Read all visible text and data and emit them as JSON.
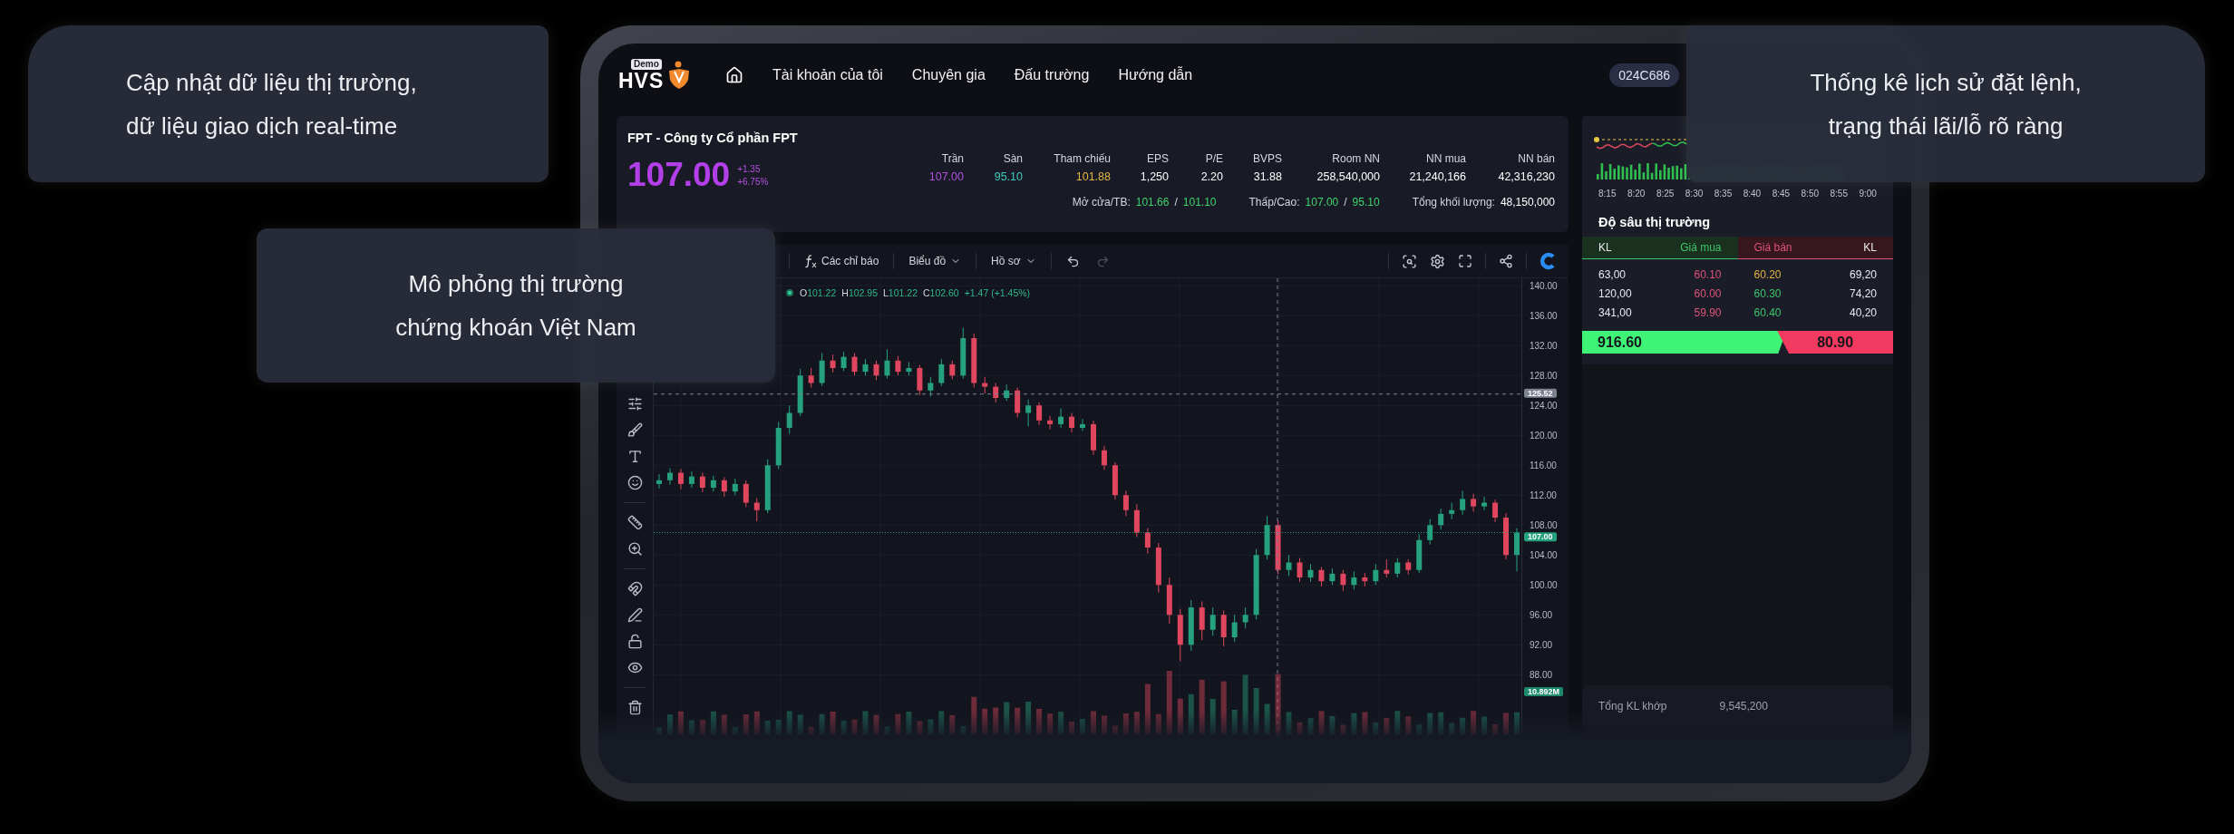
{
  "callouts": [
    {
      "lines": [
        "Cập nhật dữ liệu thị trường,",
        "dữ liệu giao dịch real-time"
      ]
    },
    {
      "lines": [
        "Mô phỏng thị trường",
        "chứng khoán Việt Nam"
      ]
    },
    {
      "lines": [
        "Thống kê lịch sử đặt lệnh,",
        "trạng thái lãi/lỗ rõ ràng"
      ]
    }
  ],
  "header": {
    "logo": {
      "badge": "Demo",
      "text": "HVS"
    },
    "nav": [
      "Tài khoản của tôi",
      "Chuyên gia",
      "Đấu trường",
      "Hướng dẫn"
    ],
    "account": "024C686"
  },
  "quote": {
    "title": "FPT - Công ty Cổ phần FPT",
    "price": "107.00",
    "change": "+1.35",
    "change_pct": "+6.75%",
    "stats": [
      {
        "label": "Trần",
        "value": "107.00",
        "color": "#b34fe0"
      },
      {
        "label": "Sàn",
        "value": "95.10",
        "color": "#3fc8c0"
      },
      {
        "label": "Tham chiếu",
        "value": "101.88",
        "color": "#e6b445"
      },
      {
        "label": "EPS",
        "value": "1,250",
        "color": "#ffffff"
      },
      {
        "label": "P/E",
        "value": "2.20",
        "color": "#ffffff"
      },
      {
        "label": "BVPS",
        "value": "31.88",
        "color": "#ffffff"
      },
      {
        "label": "Room NN",
        "value": "258,540,000",
        "color": "#ffffff"
      },
      {
        "label": "NN mua",
        "value": "21,240,166",
        "color": "#ffffff"
      },
      {
        "label": "NN bán",
        "value": "42,316,230",
        "color": "#ffffff"
      }
    ],
    "summary": [
      {
        "label": "Mở cửa/TB:",
        "values": [
          "101.66",
          "101.10"
        ],
        "separator": "/",
        "color": "#3ed46e"
      },
      {
        "label": "Thấp/Cao:",
        "values": [
          "107.00",
          "95.10"
        ],
        "separator": "/",
        "color": "#3ed46e"
      },
      {
        "label": "Tổng khối lượng:",
        "values": [
          "48,150,000"
        ],
        "color": "#ffffff"
      }
    ]
  },
  "chart_toolbar": {
    "menus": [
      {
        "label": "Các chỉ báo",
        "kind": "indicator"
      },
      {
        "label": "Biểu đồ",
        "kind": "dropdown"
      },
      {
        "label": "Hồ sơ",
        "kind": "dropdown"
      }
    ],
    "undo": {
      "disabled": false
    },
    "redo": {
      "disabled": true
    }
  },
  "chart": {
    "legend": [
      {
        "key": "O",
        "value": "101.22"
      },
      {
        "key": "H",
        "value": "102.95"
      },
      {
        "key": "L",
        "value": "101.22"
      },
      {
        "key": "C",
        "value": "102.60"
      }
    ],
    "legend_change": "+1.47 (+1.45%)",
    "chart_data": {
      "type": "candlestick",
      "grid": true,
      "ylim": [
        73.5,
        141
      ],
      "ref_lines": [
        {
          "axis": "y",
          "value": 125.52,
          "label": "125.52",
          "color": "#7d8291"
        },
        {
          "axis": "y",
          "value": 107,
          "label": "107.00",
          "color": "#26a17f"
        }
      ],
      "yticks": [
        {
          "value": 140,
          "label": "140.00"
        },
        {
          "value": 136,
          "label": "136.00"
        },
        {
          "value": 132,
          "label": "132.00"
        },
        {
          "value": 128,
          "label": "128.00"
        },
        {
          "value": 124,
          "label": "124.00"
        },
        {
          "value": 120,
          "label": "120.00"
        },
        {
          "value": 116,
          "label": "116.00"
        },
        {
          "value": 112,
          "label": "112.00"
        },
        {
          "value": 108,
          "label": "108.00"
        },
        {
          "value": 104,
          "label": "104.00"
        },
        {
          "value": 100,
          "label": "100.00"
        },
        {
          "value": 96,
          "label": "96.00"
        },
        {
          "value": 92,
          "label": "92.00"
        },
        {
          "value": 88,
          "label": "88.00"
        }
      ],
      "ohlc": [
        [
          113.5,
          114.8,
          112.9,
          114
        ],
        [
          114,
          115.6,
          113.4,
          115
        ],
        [
          115,
          115.5,
          112.8,
          113.5
        ],
        [
          113.5,
          115.2,
          113,
          114.5
        ],
        [
          114.5,
          115,
          112.4,
          113
        ],
        [
          113,
          114.6,
          112.5,
          114
        ],
        [
          114,
          114.4,
          111.8,
          112.5
        ],
        [
          112.5,
          114.2,
          112,
          113.5
        ],
        [
          113.5,
          114,
          110.4,
          111
        ],
        [
          111,
          111.6,
          108.5,
          110
        ],
        [
          110,
          116.8,
          109.6,
          116
        ],
        [
          116,
          121.8,
          115.5,
          121
        ],
        [
          121,
          124,
          120.2,
          123
        ],
        [
          123,
          128.9,
          122.6,
          128
        ],
        [
          128,
          129,
          126.4,
          127
        ],
        [
          127,
          131,
          126.6,
          130
        ],
        [
          130,
          130.8,
          128.4,
          129
        ],
        [
          129,
          131.2,
          128.6,
          130.5
        ],
        [
          130.5,
          131,
          128,
          128.5
        ],
        [
          128.5,
          130.2,
          128,
          129.5
        ],
        [
          129.5,
          130,
          127.4,
          128
        ],
        [
          128,
          131.5,
          127.6,
          130
        ],
        [
          130,
          130.6,
          128,
          128.5
        ],
        [
          128.5,
          129.8,
          128,
          129
        ],
        [
          129,
          129.4,
          125.4,
          126
        ],
        [
          126,
          127.8,
          125.2,
          127
        ],
        [
          127,
          130.2,
          126.6,
          129.5
        ],
        [
          129.5,
          130,
          127.5,
          128
        ],
        [
          128,
          134.4,
          127.6,
          133
        ],
        [
          133,
          133.6,
          126.4,
          127
        ],
        [
          127,
          127.8,
          125.6,
          126.5
        ],
        [
          126.5,
          127,
          124.4,
          125
        ],
        [
          125,
          126.8,
          124.6,
          126
        ],
        [
          126,
          126.4,
          122.4,
          123
        ],
        [
          123,
          124.8,
          121.2,
          124
        ],
        [
          124,
          124.4,
          121.4,
          122
        ],
        [
          122,
          122.6,
          120.8,
          121.5
        ],
        [
          121.5,
          123.6,
          121,
          122.5
        ],
        [
          122.5,
          123,
          120.4,
          121
        ],
        [
          121,
          122.2,
          120.6,
          121.5
        ],
        [
          121.5,
          122,
          117.4,
          118
        ],
        [
          118,
          118.6,
          115.4,
          116
        ],
        [
          116,
          116.4,
          111.4,
          112
        ],
        [
          112,
          112.6,
          109.2,
          110
        ],
        [
          110,
          110.8,
          106.4,
          107
        ],
        [
          107,
          107.6,
          104.2,
          105
        ],
        [
          105,
          105.6,
          99,
          100
        ],
        [
          100,
          101,
          94.8,
          96
        ],
        [
          96,
          96.8,
          89.8,
          92
        ],
        [
          92,
          98,
          91.2,
          97
        ],
        [
          97,
          97.8,
          92.6,
          94
        ],
        [
          94,
          97,
          93.2,
          96
        ],
        [
          96,
          96.6,
          91.8,
          93
        ],
        [
          93,
          96,
          92.4,
          95
        ],
        [
          95,
          97,
          94.2,
          96
        ],
        [
          96,
          104.8,
          95.4,
          104
        ],
        [
          104,
          109.2,
          103.4,
          108
        ],
        [
          108,
          108.6,
          101.4,
          102
        ],
        [
          102,
          104,
          101.2,
          103
        ],
        [
          103,
          103.6,
          100.4,
          101
        ],
        [
          101,
          102.8,
          100.4,
          102
        ],
        [
          102,
          102.4,
          99.8,
          100.5
        ],
        [
          100.5,
          102.2,
          100,
          101.5
        ],
        [
          101.5,
          102,
          99.2,
          100
        ],
        [
          100,
          101.8,
          99.4,
          101
        ],
        [
          101,
          101.6,
          99.8,
          100.5
        ],
        [
          100.5,
          102.8,
          100,
          102
        ],
        [
          102,
          103.4,
          101,
          101.5
        ],
        [
          101.5,
          103.6,
          101,
          103
        ],
        [
          103,
          103.4,
          101.4,
          102
        ],
        [
          102,
          106.8,
          101.6,
          106
        ],
        [
          106,
          108.8,
          105.4,
          108
        ],
        [
          108,
          110.2,
          107.4,
          109.5
        ],
        [
          109.5,
          111,
          108.8,
          110
        ],
        [
          110,
          112.6,
          109.4,
          111.5
        ],
        [
          111.5,
          112.2,
          109.8,
          110.5
        ],
        [
          110.5,
          111.8,
          110,
          111
        ],
        [
          111,
          111.4,
          108.4,
          109
        ],
        [
          109,
          109.6,
          103.4,
          104
        ],
        [
          104,
          107.6,
          101.8,
          107
        ]
      ]
    },
    "volume_label": "10.892M"
  },
  "depth": {
    "times": [
      "8:15",
      "8:20",
      "8:25",
      "8:30",
      "8:35",
      "8:40",
      "8:45",
      "8:50",
      "8:55",
      "9:00"
    ],
    "title": "Độ sâu thị trường",
    "columns": [
      "KL",
      "Giá mua",
      "Giá bán",
      "KL"
    ],
    "rows": [
      {
        "buy_volume": "63,00",
        "buy_price": {
          "text": "60.10",
          "color": "#e0527a"
        },
        "sell_price": {
          "text": "60.20",
          "color": "#e6b445"
        },
        "sell_volume": "69,20"
      },
      {
        "buy_volume": "120,00",
        "buy_price": {
          "text": "60.00",
          "color": "#e0527a"
        },
        "sell_price": {
          "text": "60.30",
          "color": "#3ec46d"
        },
        "sell_volume": "74,20"
      },
      {
        "buy_volume": "341,00",
        "buy_price": {
          "text": "59.90",
          "color": "#e0527a"
        },
        "sell_price": {
          "text": "60.40",
          "color": "#3ec46d"
        },
        "sell_volume": "40,20"
      }
    ],
    "buy_total": "916.60",
    "sell_total": "80.90"
  },
  "match": {
    "label": "Tổng KL khớp",
    "value": "9,545,200"
  }
}
